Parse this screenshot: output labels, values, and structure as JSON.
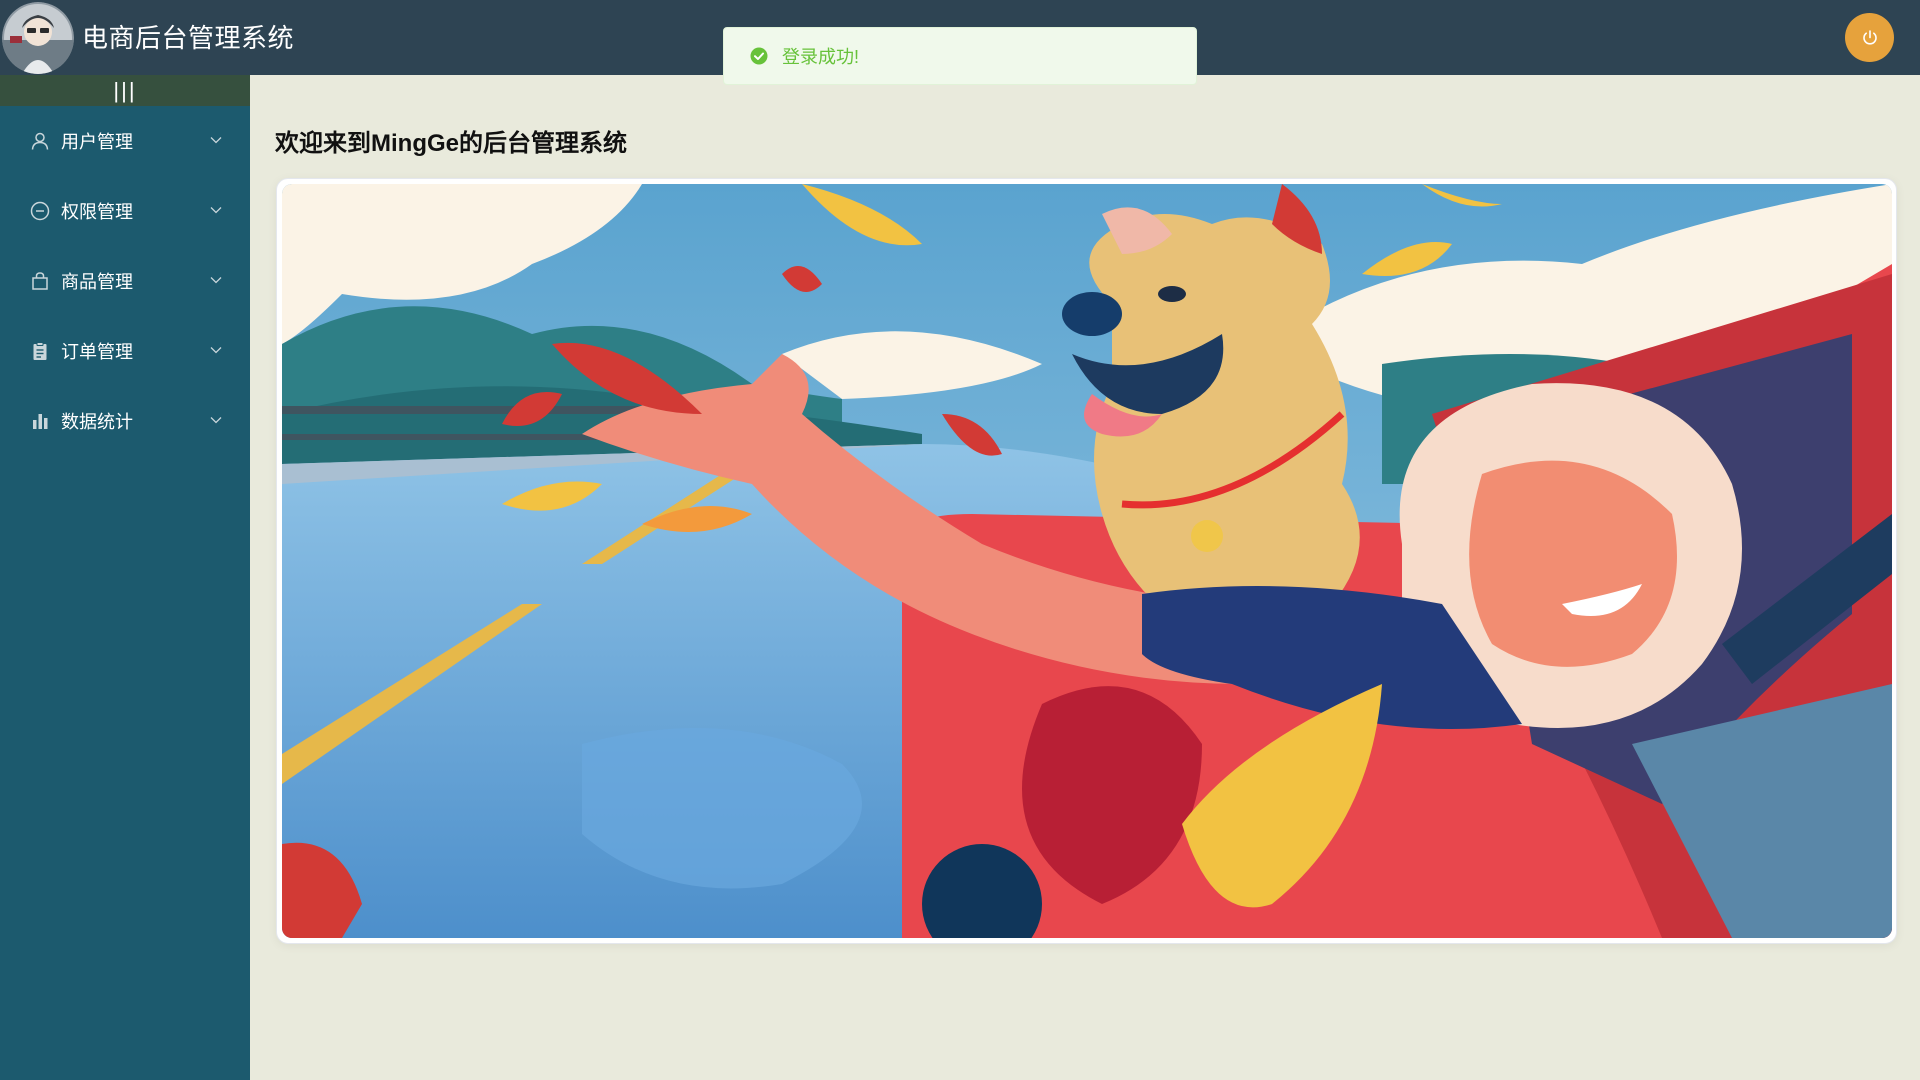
{
  "header": {
    "title": "电商后台管理系统",
    "avatar_icon": "user-avatar",
    "power_icon": "power-icon",
    "power_color": "#e6a23c",
    "background": "#2e4453"
  },
  "toast": {
    "message": "登录成功!",
    "icon": "check-circle-icon",
    "color": "#67c23a"
  },
  "sidebar": {
    "toggle_label": "|||",
    "background": "#1c5a6e",
    "items": [
      {
        "label": "用户管理",
        "icon": "user-icon"
      },
      {
        "label": "权限管理",
        "icon": "minus-circle-icon"
      },
      {
        "label": "商品管理",
        "icon": "shopping-bag-icon"
      },
      {
        "label": "订单管理",
        "icon": "clipboard-icon"
      },
      {
        "label": "数据统计",
        "icon": "bar-chart-icon"
      }
    ]
  },
  "main": {
    "welcome": "欢迎来到MingGe的后台管理系统",
    "background": "#e9eadc",
    "banner_image": "illustration-dog-and-girl-in-red-car"
  }
}
